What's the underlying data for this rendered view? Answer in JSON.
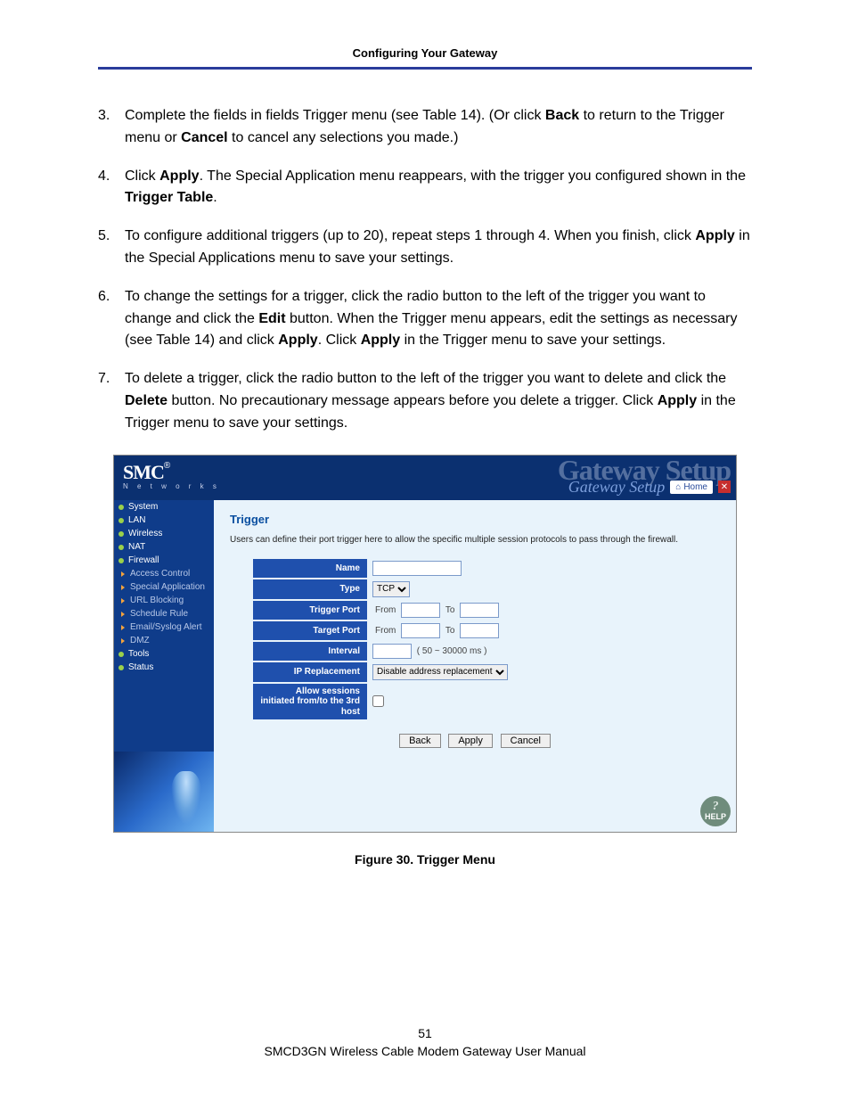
{
  "header": {
    "title": "Configuring Your Gateway"
  },
  "steps": [
    {
      "num": "3.",
      "html": "Complete the fields in fields Trigger menu (see Table 14). (Or click <b>Back</b> to return to the Trigger menu or <b>Cancel</b> to cancel any selections you made.)"
    },
    {
      "num": "4.",
      "html": "Click <b>Apply</b>. The Special Application menu reappears, with the trigger you configured shown in the <b>Trigger Table</b>."
    },
    {
      "num": "5.",
      "html": "To configure additional triggers (up to 20), repeat steps 1 through 4. When you finish, click <b>Apply</b> in the Special Applications menu to save your settings."
    },
    {
      "num": "6.",
      "html": "To change the settings for a trigger, click the radio button to the left of the trigger you want to change and click the <b>Edit</b> button. When the Trigger menu appears, edit the settings as necessary (see Table 14) and click <b>Apply</b>. Click <b>Apply</b> in the Trigger menu to save your settings."
    },
    {
      "num": "7.",
      "html": "To delete a trigger, click the radio button to the left of the trigger you want to delete and click the <b>Delete</b> button. No precautionary message appears before you delete a trigger. Click <b>Apply</b> in the Trigger menu to save your settings."
    }
  ],
  "ui": {
    "logo_main": "SMC",
    "logo_reg": "®",
    "logo_sub": "N e t w o r k s",
    "ghost": "Gateway Setup",
    "breadcrumb": "Gateway Setup",
    "home_label": "Home",
    "logout_glyph": "✕",
    "sidebar": [
      {
        "type": "top",
        "cls": "green",
        "label": "System",
        "name": "nav-system"
      },
      {
        "type": "top",
        "cls": "green",
        "label": "LAN",
        "name": "nav-lan"
      },
      {
        "type": "top",
        "cls": "green",
        "label": "Wireless",
        "name": "nav-wireless"
      },
      {
        "type": "top",
        "cls": "green",
        "label": "NAT",
        "name": "nav-nat"
      },
      {
        "type": "top",
        "cls": "green",
        "label": "Firewall",
        "name": "nav-firewall"
      },
      {
        "type": "sub",
        "label": "Access Control",
        "name": "nav-access-control"
      },
      {
        "type": "sub",
        "label": "Special Application",
        "name": "nav-special-application"
      },
      {
        "type": "sub",
        "label": "URL Blocking",
        "name": "nav-url-blocking"
      },
      {
        "type": "sub",
        "label": "Schedule Rule",
        "name": "nav-schedule-rule"
      },
      {
        "type": "sub",
        "label": "Email/Syslog Alert",
        "name": "nav-email-syslog-alert"
      },
      {
        "type": "sub",
        "label": "DMZ",
        "name": "nav-dmz"
      },
      {
        "type": "top",
        "cls": "green",
        "label": "Tools",
        "name": "nav-tools"
      },
      {
        "type": "top",
        "cls": "green",
        "label": "Status",
        "name": "nav-status"
      }
    ],
    "content": {
      "title": "Trigger",
      "desc": "Users can define their port trigger here to allow the specific multiple session protocols to pass through the firewall.",
      "rows": {
        "name": "Name",
        "type": "Type",
        "trigger_port": "Trigger Port",
        "target_port": "Target Port",
        "interval": "Interval",
        "interval_hint": "( 50 ~ 30000  ms )",
        "ip_replacement": "IP Replacement",
        "allow": "Allow sessions initiated from/to the 3rd host"
      },
      "type_option": "TCP",
      "ip_option": "Disable address replacement",
      "from": "From",
      "to": "To",
      "buttons": {
        "back": "Back",
        "apply": "Apply",
        "cancel": "Cancel"
      },
      "help": "HELP"
    }
  },
  "figure_caption": "Figure 30. Trigger Menu",
  "footer": {
    "page": "51",
    "text": "SMCD3GN Wireless Cable Modem Gateway User Manual"
  }
}
